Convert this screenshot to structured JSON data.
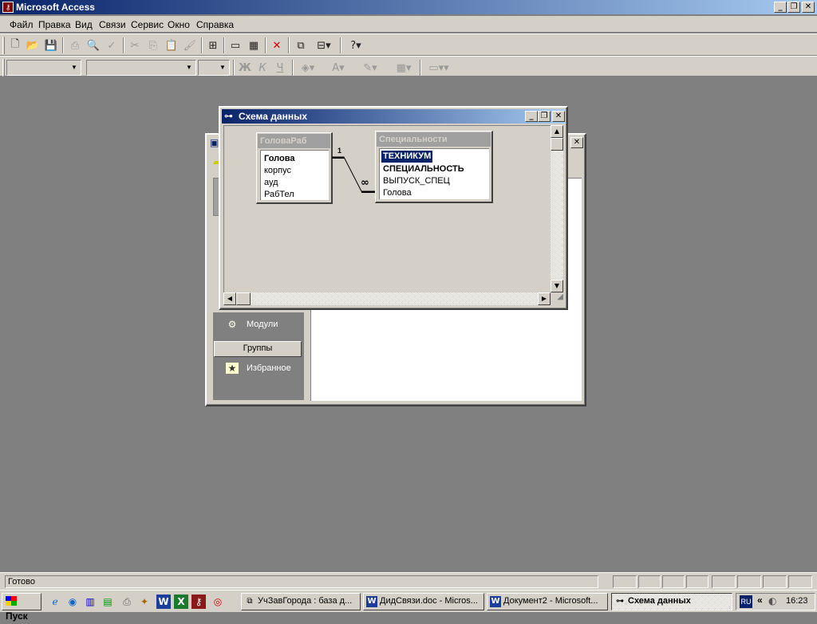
{
  "app": {
    "title": "Microsoft Access",
    "icon": "access-key-icon"
  },
  "window_controls": {
    "minimize": "_",
    "restore": "❐",
    "close": "✕"
  },
  "menu": [
    "Файл",
    "Правка",
    "Вид",
    "Связи",
    "Сервис",
    "Окно",
    "Справка"
  ],
  "toolbar_formatting": {
    "bold": "Ж",
    "italic": "К",
    "underline": "Ч"
  },
  "db_window": {
    "objects": [
      {
        "label": "Модули",
        "icon": "modules-icon"
      },
      {
        "label": "Избранное",
        "icon": "favorites-icon"
      }
    ],
    "groups_label": "Группы"
  },
  "relationships": {
    "title": "Схема данных",
    "table1": {
      "name": "ГоловаРаб",
      "fields": [
        "Голова",
        "корпус",
        "ауд",
        "РабТел"
      ],
      "key_fields": [
        "Голова"
      ]
    },
    "table2": {
      "name": "Специальности",
      "fields": [
        "ТЕХНИКУМ",
        "СПЕЦИАЛЬНОСТЬ",
        "ВЫПУСК_СПЕЦ",
        "Голова"
      ],
      "key_fields": [
        "ТЕХНИКУМ",
        "СПЕЦИАЛЬНОСТЬ"
      ],
      "selected_field": "ТЕХНИКУМ"
    },
    "join": {
      "one_label": "1",
      "many_label": "∞"
    }
  },
  "status": {
    "text": "Готово"
  },
  "taskbar": {
    "start_label": "Пуск",
    "tasks": [
      {
        "label": "УчЗавГорода : база д...",
        "icon": "database-icon"
      },
      {
        "label": "ДидСвязи.doc - Micros...",
        "icon": "word-icon"
      },
      {
        "label": "Документ2 - Microsoft...",
        "icon": "word-icon"
      },
      {
        "label": "Схема данных",
        "icon": "relationships-icon",
        "active": true
      }
    ],
    "lang": "RU",
    "clock": "16:23"
  },
  "colors": {
    "titlebar_start": "#0a246a",
    "titlebar_end": "#a6caf0",
    "face": "#d4d0c8",
    "desktop": "#808080"
  }
}
